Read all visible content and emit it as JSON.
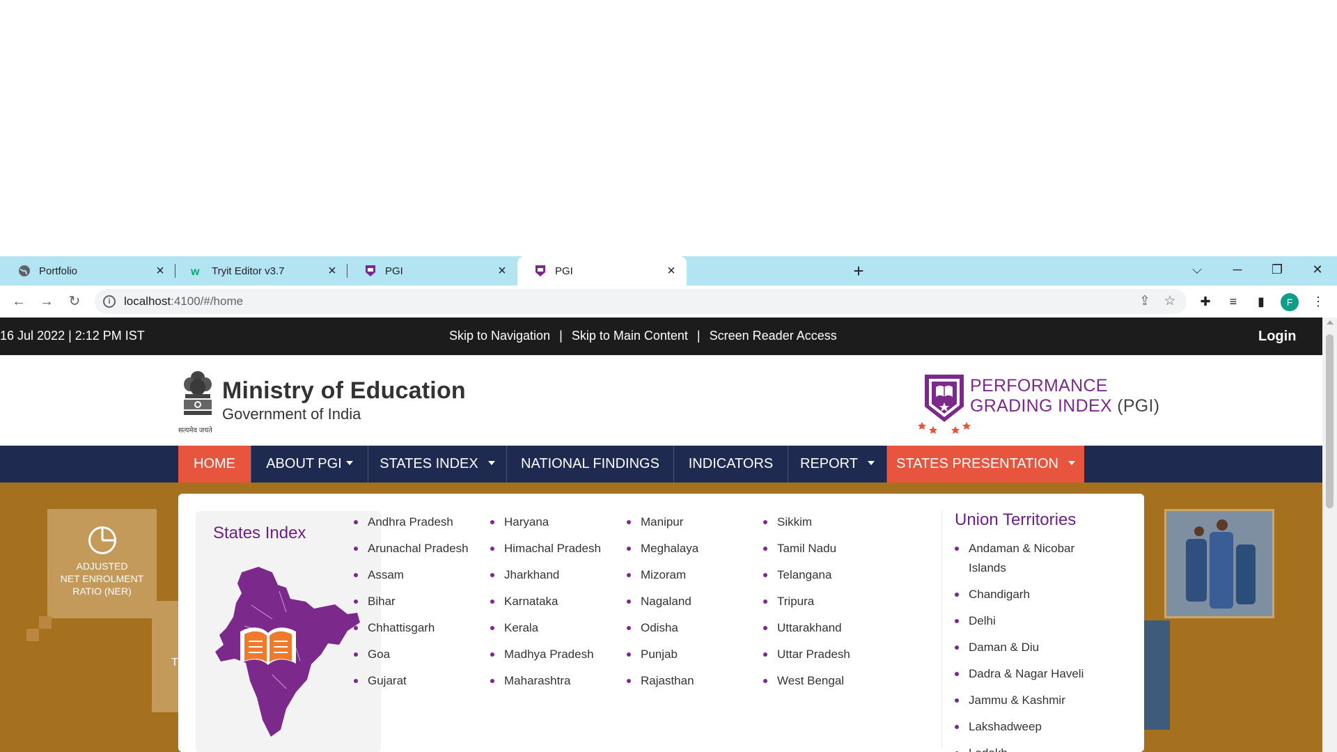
{
  "browser": {
    "tabs": [
      {
        "title": "Portfolio",
        "favicon": "globe-icon"
      },
      {
        "title": "Tryit Editor v3.7",
        "favicon": "w3schools-icon"
      },
      {
        "title": "PGI",
        "favicon": "pgi-icon"
      },
      {
        "title": "PGI",
        "favicon": "pgi-icon",
        "active": true
      }
    ],
    "url_host": "localhost",
    "url_path": ":4100/#/home",
    "profile_initial": "F"
  },
  "topbar": {
    "datetime": "16 Jul 2022  |  2:12 PM IST",
    "skip_nav": "Skip to Navigation",
    "sep": "|",
    "skip_main": "Skip to Main Content",
    "screen_reader": "Screen Reader Access",
    "login": "Login"
  },
  "header": {
    "ministry_title": "Ministry of Education",
    "ministry_sub": "Government of India",
    "emblem_motto": "सत्यमेव जयते",
    "pgi_line1": "PERFORMANCE",
    "pgi_line2": "GRADING INDEX",
    "pgi_abbr": "(PGI)"
  },
  "nav": {
    "items": [
      {
        "label": "HOME",
        "caret": false
      },
      {
        "label": "ABOUT PGI",
        "caret": true
      },
      {
        "label": "STATES INDEX",
        "caret": true
      },
      {
        "label": "NATIONAL FINDINGS",
        "caret": false
      },
      {
        "label": "INDICATORS",
        "caret": false
      },
      {
        "label": "REPORT",
        "caret": true
      },
      {
        "label": "STATES PRESENTATION",
        "caret": true
      }
    ]
  },
  "hero": {
    "tile_label": "ADJUSTED\nNET ENROLMENT\nRATIO (NER)",
    "tile2_letter": "T"
  },
  "dropdown": {
    "states_index_title": "States Index",
    "columns": [
      [
        "Andhra Pradesh",
        "Arunachal Pradesh",
        "Assam",
        "Bihar",
        "Chhattisgarh",
        "Goa",
        "Gujarat"
      ],
      [
        "Haryana",
        "Himachal Pradesh",
        "Jharkhand",
        "Karnataka",
        "Kerala",
        "Madhya Pradesh",
        "Maharashtra"
      ],
      [
        "Manipur",
        "Meghalaya",
        "Mizoram",
        "Nagaland",
        "Odisha",
        "Punjab",
        "Rajasthan"
      ],
      [
        "Sikkim",
        "Tamil Nadu",
        "Telangana",
        "Tripura",
        "Uttarakhand",
        "Uttar Pradesh",
        "West Bengal"
      ]
    ],
    "ut_title": "Union Territories",
    "ut_items": [
      "Andaman & Nicobar Islands",
      "Chandigarh",
      "Delhi",
      "Daman & Diu",
      "Dadra & Nagar Haveli",
      "Jammu & Kashmir",
      "Lakshadweep",
      "Ladakh"
    ]
  },
  "colors": {
    "accent_orange": "#e8553f",
    "nav_navy": "#1e2a4f",
    "pgi_purple": "#7b2a8c"
  }
}
